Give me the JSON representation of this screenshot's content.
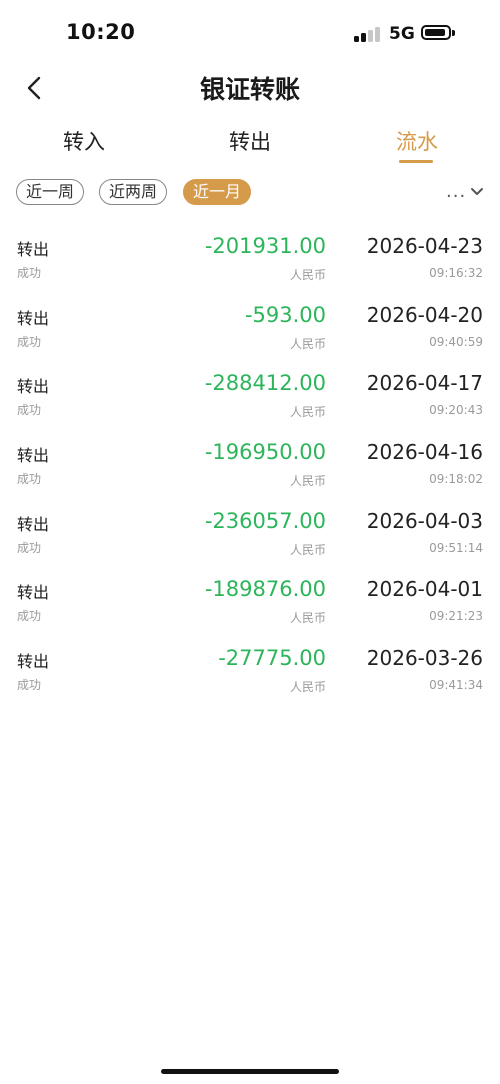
{
  "status_bar": {
    "time": "10:20",
    "network": "5G"
  },
  "header": {
    "back_icon": "chevron-left-icon",
    "title": "银证转账"
  },
  "tabs": [
    {
      "label": "转入",
      "active": false
    },
    {
      "label": "转出",
      "active": false
    },
    {
      "label": "流水",
      "active": true
    }
  ],
  "filters": {
    "chips": [
      {
        "label": "近一周",
        "active": false
      },
      {
        "label": "近两周",
        "active": false
      },
      {
        "label": "近一月",
        "active": true
      }
    ],
    "more_label": "...",
    "more_icon": "chevron-down-icon"
  },
  "records": [
    {
      "type": "转出",
      "status": "成功",
      "amount": "-201931.00",
      "currency": "人民币",
      "date": "2026-04-23",
      "time": "09:16:32"
    },
    {
      "type": "转出",
      "status": "成功",
      "amount": "-593.00",
      "currency": "人民币",
      "date": "2026-04-20",
      "time": "09:40:59"
    },
    {
      "type": "转出",
      "status": "成功",
      "amount": "-288412.00",
      "currency": "人民币",
      "date": "2026-04-17",
      "time": "09:20:43"
    },
    {
      "type": "转出",
      "status": "成功",
      "amount": "-196950.00",
      "currency": "人民币",
      "date": "2026-04-16",
      "time": "09:18:02"
    },
    {
      "type": "转出",
      "status": "成功",
      "amount": "-236057.00",
      "currency": "人民币",
      "date": "2026-04-03",
      "time": "09:51:14"
    },
    {
      "type": "转出",
      "status": "成功",
      "amount": "-189876.00",
      "currency": "人民币",
      "date": "2026-04-01",
      "time": "09:21:23"
    },
    {
      "type": "转出",
      "status": "成功",
      "amount": "-27775.00",
      "currency": "人民币",
      "date": "2026-03-26",
      "time": "09:41:34"
    }
  ],
  "colors": {
    "accent": "#d69a4b",
    "amount": "#2cb55a",
    "muted": "#9a9a9a"
  }
}
